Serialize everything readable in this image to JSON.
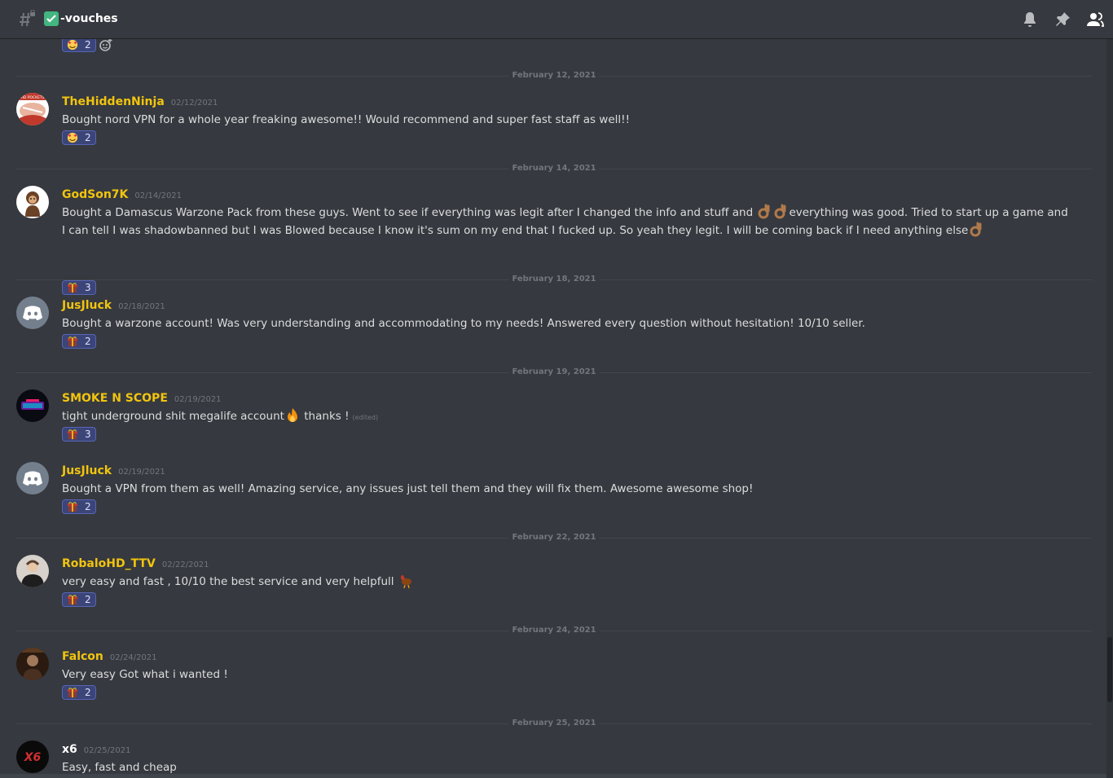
{
  "channel": {
    "name": "-vouches"
  },
  "top_reaction": {
    "count": "2"
  },
  "dividers": [
    "February 12, 2021",
    "February 14, 2021",
    "February 18, 2021",
    "February 19, 2021",
    "February 22, 2021",
    "February 24, 2021",
    "February 25, 2021"
  ],
  "messages": [
    {
      "username": "TheHiddenNinja",
      "timestamp": "02/12/2021",
      "text": "Bought nord VPN for a whole year freaking awesome!! Would recommend and super fast staff as well!!",
      "reaction_count": "2",
      "avatar_text": "HD POCKETS"
    },
    {
      "username": "GodSon7K",
      "timestamp": "02/14/2021",
      "text_a": "Bought a Damascus Warzone Pack from these guys. Went to see if everything was legit after I changed the info and stuff and ",
      "text_b": "everything was good. Tried to start up a game and I can tell I was shadowbanned but I was Blowed because I know it's sum on my end that I fucked up. So yeah they legit. I will be coming back if I need anything else",
      "reaction_count": "3"
    },
    {
      "username": "JusJluck",
      "timestamp": "02/18/2021",
      "text": "Bought a warzone account! Was very understanding and accommodating to my needs! Answered every question without hesitation! 10/10 seller.",
      "reaction_count": "2"
    },
    {
      "username": "SMOKE N SCOPE",
      "timestamp": "02/19/2021",
      "text_a": "tight underground shit megalife account",
      "text_b": " thanks !",
      "edited": "(edited)",
      "reaction_count": "3"
    },
    {
      "username": "JusJluck",
      "timestamp": "02/19/2021",
      "text": "Bought a VPN from them as well! Amazing service, any issues just tell them and they will fix them. Awesome awesome shop!",
      "reaction_count": "2"
    },
    {
      "username": "RobaloHD_TTV",
      "timestamp": "02/22/2021",
      "text": "very easy and fast , 10/10 the best service and very helpfull ",
      "reaction_count": "2"
    },
    {
      "username": "Falcon",
      "timestamp": "02/24/2021",
      "text": "Very easy Got what i wanted !",
      "reaction_count": "2"
    },
    {
      "username": "x6",
      "timestamp": "02/25/2021",
      "text": "Easy, fast and cheap",
      "avatar_text": "X6"
    }
  ],
  "colors": {
    "background": "#36393f",
    "username": "#f1c40f",
    "reaction_bg": "#3b4578"
  },
  "icons": {
    "header": [
      "hashtag-lock-icon",
      "checkmark-icon",
      "bell-icon",
      "pin-icon",
      "members-icon"
    ],
    "reactions": [
      "smiling-hearts-emoji",
      "custom-gift-emoji",
      "ok-hand-emoji",
      "fire-emoji",
      "turkey-emoji"
    ]
  }
}
